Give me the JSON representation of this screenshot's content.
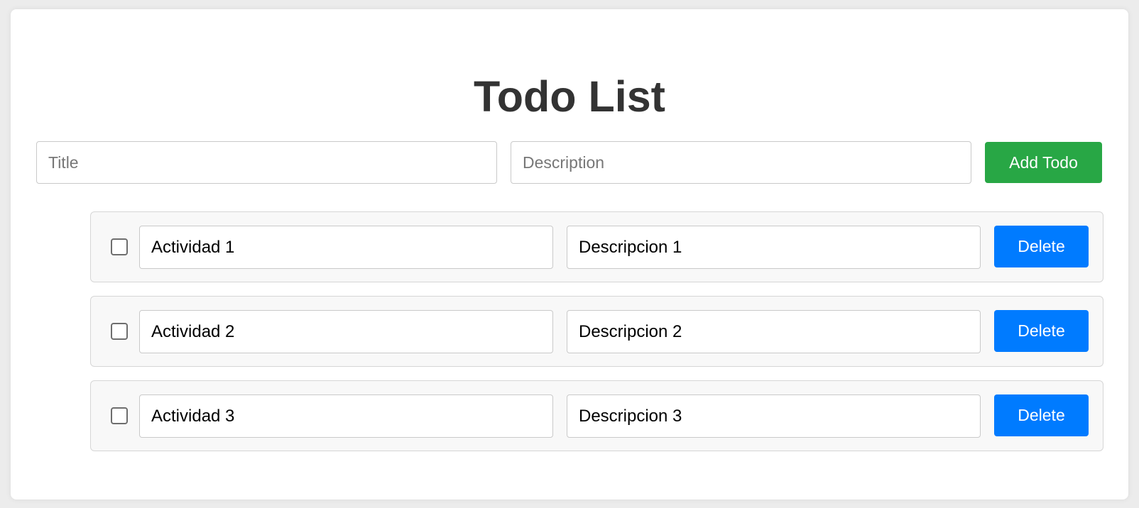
{
  "header": {
    "title": "Todo List"
  },
  "form": {
    "title_placeholder": "Title",
    "title_value": "",
    "description_placeholder": "Description",
    "description_value": "",
    "add_button_label": "Add Todo"
  },
  "todos": [
    {
      "title": "Actividad 1",
      "description": "Descripcion 1",
      "completed": false,
      "delete_label": "Delete"
    },
    {
      "title": "Actividad 2",
      "description": "Descripcion 2",
      "completed": false,
      "delete_label": "Delete"
    },
    {
      "title": "Actividad 3",
      "description": "Descripcion 3",
      "completed": false,
      "delete_label": "Delete"
    }
  ],
  "colors": {
    "add_button": "#28a745",
    "delete_button": "#007bff",
    "title_text": "#333333",
    "item_background": "#f8f8f8"
  }
}
